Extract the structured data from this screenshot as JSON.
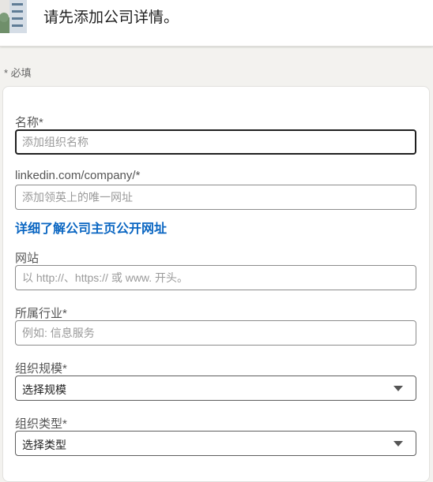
{
  "header": {
    "title": "请先添加公司详情。",
    "logo_icon": "company-logo-icon"
  },
  "form": {
    "required_note": "* 必填",
    "name": {
      "label": "名称*",
      "placeholder": "添加组织名称"
    },
    "linkedin_url": {
      "label": "linkedin.com/company/*",
      "placeholder": "添加领英上的唯一网址"
    },
    "learn_more_link": "详细了解公司主页公开网址",
    "website": {
      "label": "网站",
      "placeholder": "以 http://、https:// 或 www. 开头。"
    },
    "industry": {
      "label": "所属行业*",
      "placeholder": "例如: 信息服务"
    },
    "org_size": {
      "label": "组织规模*",
      "selected": "选择规模"
    },
    "org_type": {
      "label": "组织类型*",
      "selected": "选择类型"
    }
  },
  "colors": {
    "link": "#0a66c2",
    "page_background": "#f3f2ef"
  }
}
